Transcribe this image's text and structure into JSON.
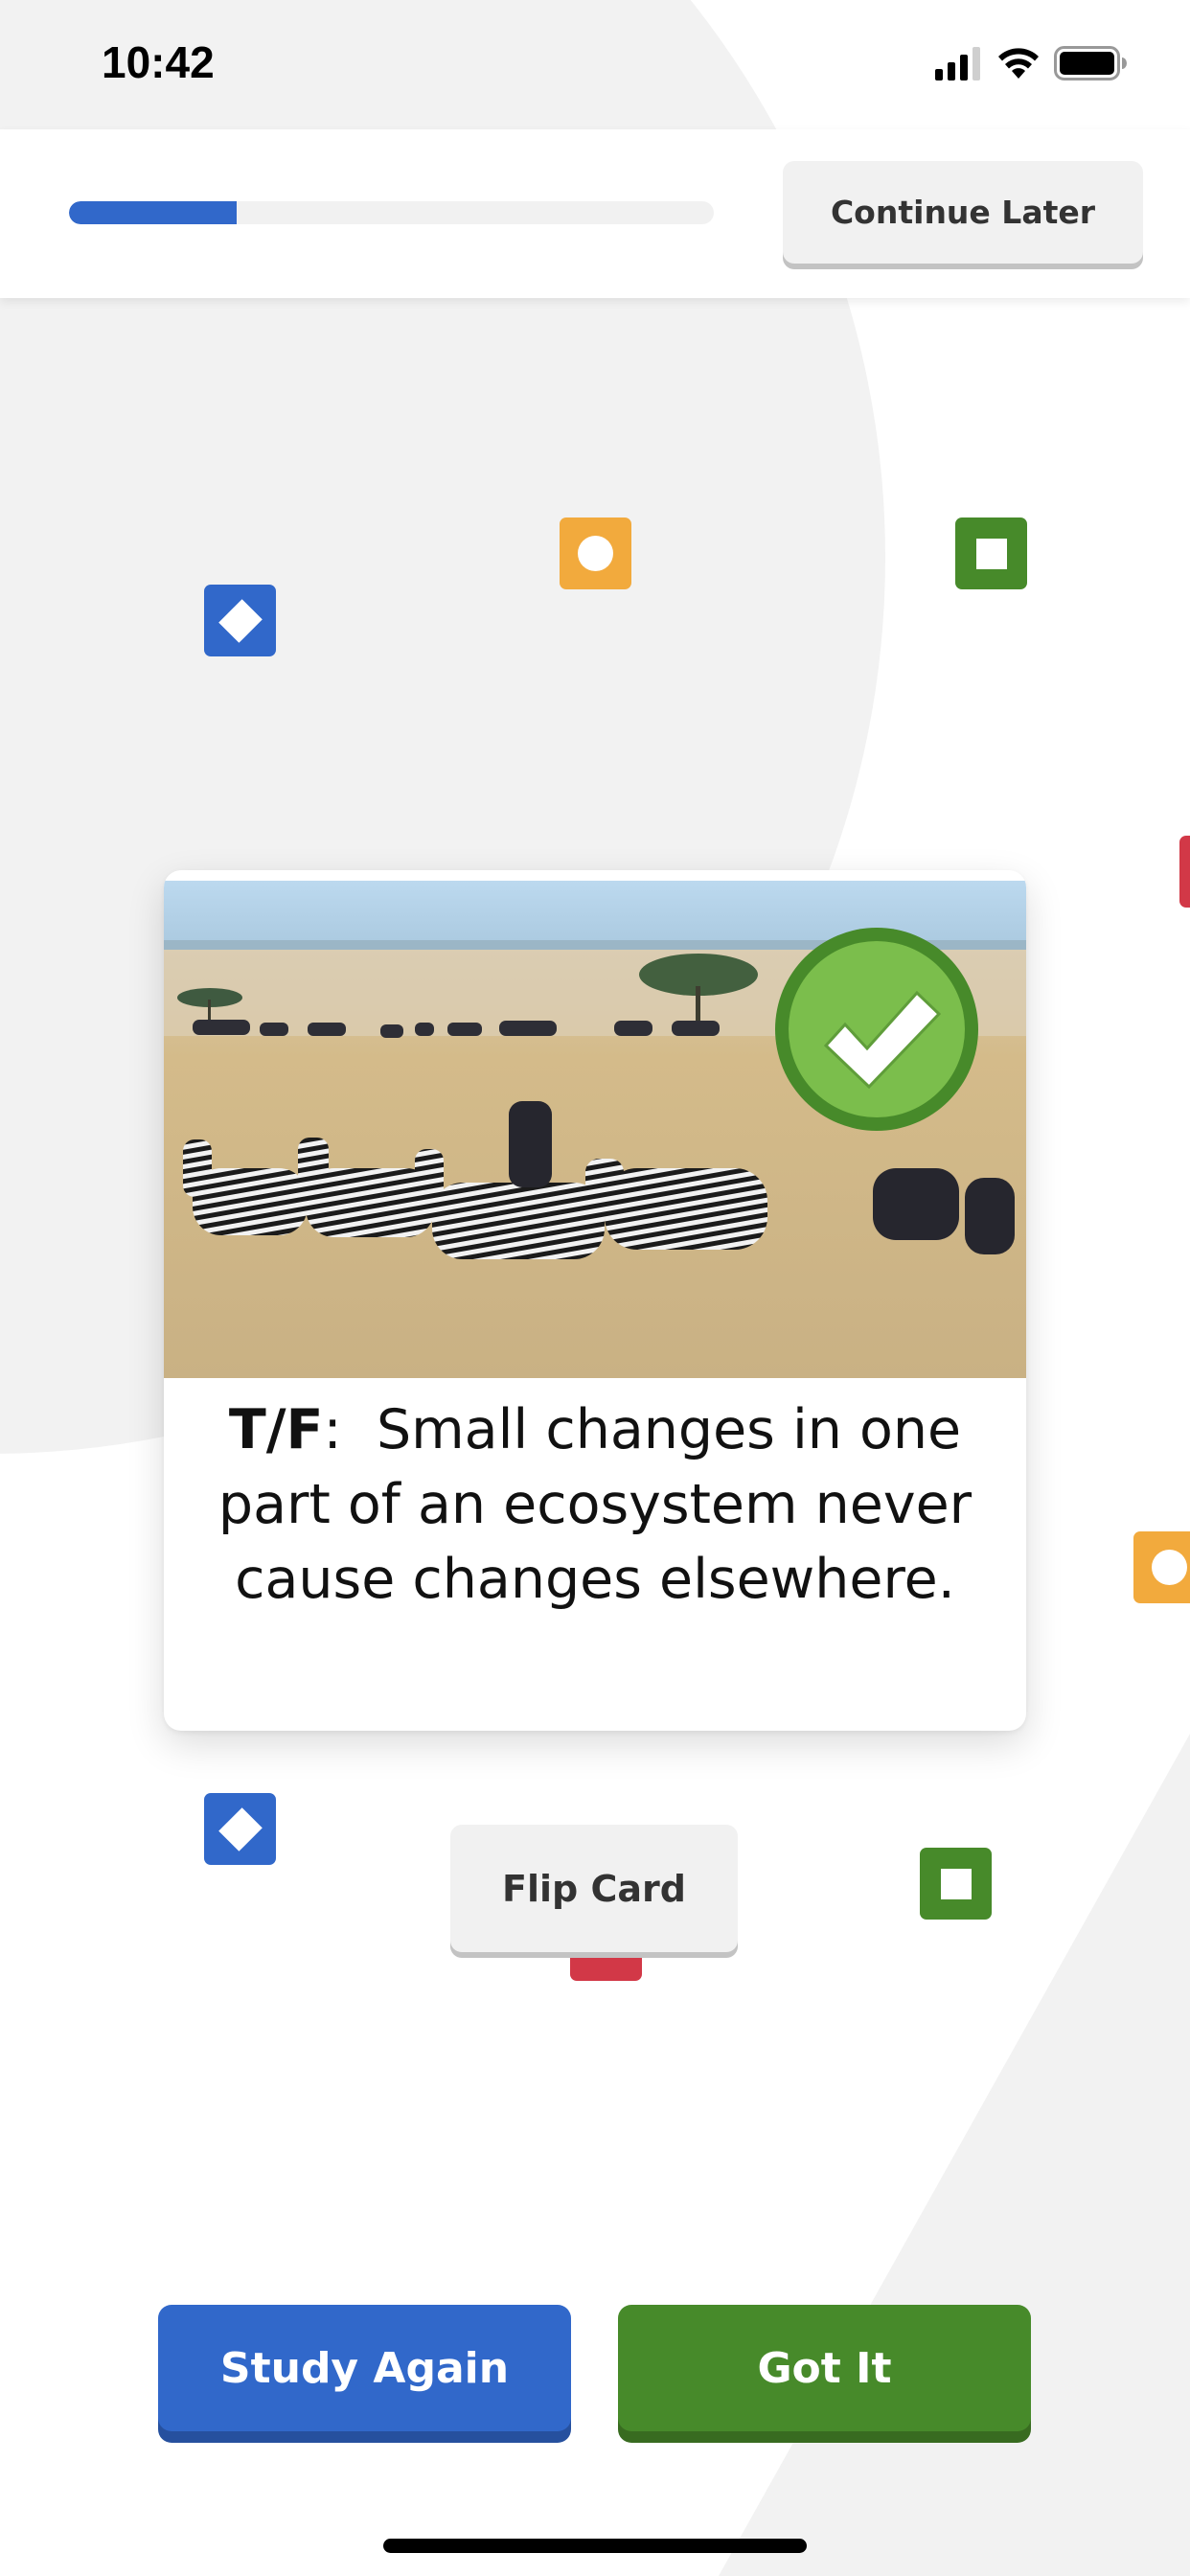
{
  "status_bar": {
    "time": "10:42",
    "signal_bars_filled": 3,
    "signal_bars_total": 4,
    "icons": [
      "signal-icon",
      "wifi-icon",
      "battery-icon"
    ]
  },
  "header": {
    "progress_percent": 26,
    "continue_later_label": "Continue Later"
  },
  "colors": {
    "blue": "#3168ca",
    "green": "#478a2a",
    "orange": "#f2aa3d",
    "red": "#d23847",
    "check_light_green": "#7bbe4c"
  },
  "decor_tiles": [
    {
      "color": "blue",
      "glyph": "diamond"
    },
    {
      "color": "orange",
      "glyph": "circle"
    },
    {
      "color": "green",
      "glyph": "square"
    },
    {
      "color": "red",
      "glyph": "partial"
    },
    {
      "color": "orange",
      "glyph": "circle"
    },
    {
      "color": "blue",
      "glyph": "diamond"
    },
    {
      "color": "green",
      "glyph": "square"
    },
    {
      "color": "red",
      "glyph": "bar"
    }
  ],
  "card": {
    "image_description": "Zebras and wildebeest grazing on a savanna grassland",
    "badge": "check-circle-icon",
    "question_prefix": "T/F",
    "question_separator": ":  ",
    "question_text": "Small changes in one part of an ecosystem never cause changes elsewhere."
  },
  "flip_card_label": "Flip Card",
  "actions": {
    "study_again_label": "Study Again",
    "got_it_label": "Got It"
  }
}
